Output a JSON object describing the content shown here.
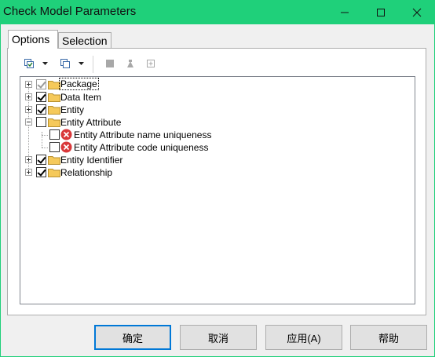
{
  "window": {
    "title": "Check Model Parameters"
  },
  "tabs": [
    {
      "label": "Options",
      "active": true
    },
    {
      "label": "Selection",
      "active": false
    }
  ],
  "toolbar": {
    "icons": [
      "select-all-icon",
      "dropdown-arrow-icon",
      "deselect-all-icon",
      "dropdown-arrow-icon",
      "square-icon",
      "triangle-icon",
      "plus-box-icon"
    ]
  },
  "tree": {
    "items": [
      {
        "label": "Package",
        "expander": "plus",
        "checked": true,
        "disabled": true,
        "icon": "folder-icon",
        "focused": true
      },
      {
        "label": "Data Item",
        "expander": "plus",
        "checked": true,
        "icon": "folder-icon"
      },
      {
        "label": "Entity",
        "expander": "plus",
        "checked": true,
        "icon": "folder-icon"
      },
      {
        "label": "Entity Attribute",
        "expander": "minus",
        "checked": false,
        "icon": "folder-icon"
      },
      {
        "label": "Entity Attribute name uniqueness",
        "checked": false,
        "icon": "error-icon",
        "child": true
      },
      {
        "label": "Entity Attribute code uniqueness",
        "checked": false,
        "icon": "error-icon",
        "child": true
      },
      {
        "label": "Entity Identifier",
        "expander": "plus",
        "checked": true,
        "icon": "folder-icon"
      },
      {
        "label": "Relationship",
        "expander": "plus",
        "checked": true,
        "icon": "folder-icon"
      }
    ]
  },
  "buttons": {
    "ok": "确定",
    "cancel": "取消",
    "apply": "应用(A)",
    "help": "帮助"
  },
  "colors": {
    "titlebar": "#1fd07a",
    "error": "#d9383a",
    "folder": "#f5c95a"
  }
}
